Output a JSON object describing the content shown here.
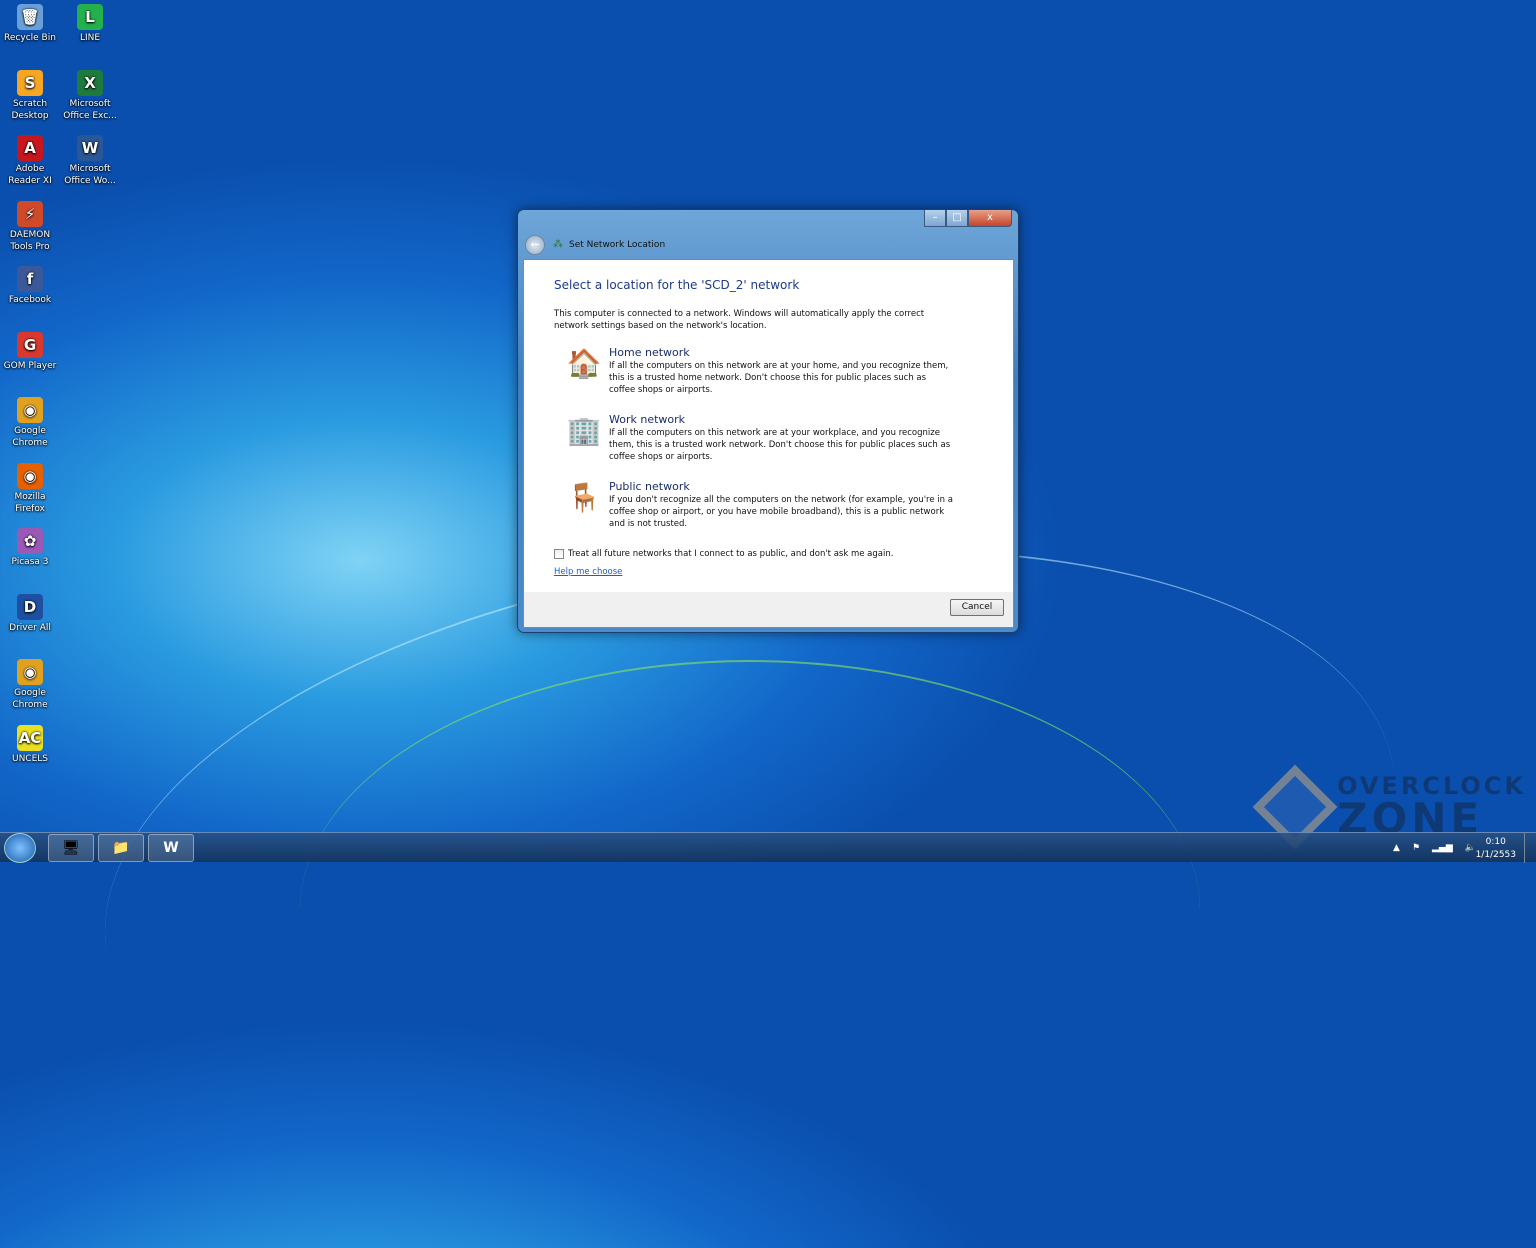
{
  "desktop": {
    "icons": [
      {
        "label": "Recycle Bin",
        "icon": "recycle-bin-icon",
        "glyph": "🗑",
        "color": "#6aa0d8"
      },
      {
        "label": "LINE",
        "icon": "line-icon",
        "glyph": "L",
        "color": "#22b14c"
      },
      {
        "label": "Scratch Desktop",
        "icon": "scratch-icon",
        "glyph": "S",
        "color": "#f6a623"
      },
      {
        "label": "Microsoft Office Exc...",
        "icon": "excel-icon",
        "glyph": "X",
        "color": "#1f7a3e"
      },
      {
        "label": "Adobe Reader XI",
        "icon": "adobe-reader-icon",
        "glyph": "A",
        "color": "#c8161d"
      },
      {
        "label": "Microsoft Office Wo...",
        "icon": "word-icon",
        "glyph": "W",
        "color": "#2b5797"
      },
      {
        "label": "DAEMON Tools Pro",
        "icon": "daemon-tools-icon",
        "glyph": "⚡",
        "color": "#d04a2a"
      },
      {
        "label": "Facebook",
        "icon": "facebook-icon",
        "glyph": "f",
        "color": "#3b5998"
      },
      {
        "label": "GOM Player",
        "icon": "gom-player-icon",
        "glyph": "G",
        "color": "#d8382e"
      },
      {
        "label": "Google Chrome",
        "icon": "chrome-icon",
        "glyph": "◉",
        "color": "#e0a020"
      },
      {
        "label": "Mozilla Firefox",
        "icon": "firefox-icon",
        "glyph": "◉",
        "color": "#e66000"
      },
      {
        "label": "Picasa 3",
        "icon": "picasa-icon",
        "glyph": "✿",
        "color": "#9b59b6"
      },
      {
        "label": "Driver All",
        "icon": "driver-all-icon",
        "glyph": "D",
        "color": "#1e4fa0"
      },
      {
        "label": "Google Chrome",
        "icon": "chrome-icon",
        "glyph": "◉",
        "color": "#e0a020"
      },
      {
        "label": "UNCELS",
        "icon": "uncels-icon",
        "glyph": "AC",
        "color": "#e8e020"
      }
    ]
  },
  "dialog": {
    "title": "Set Network Location",
    "heading": "Select a location for the 'SCD_2' network",
    "intro": "This computer is connected to a network. Windows will automatically apply the correct network settings based on the network's location.",
    "options": [
      {
        "title": "Home network",
        "desc": "If all the computers on this network are at your home, and you recognize them, this is a trusted home network. Don't choose this for public places such as coffee shops or airports.",
        "glyph": "🏠"
      },
      {
        "title": "Work network",
        "desc": "If all the computers on this network are at your workplace, and you recognize them, this is a trusted work network. Don't choose this for public places such as coffee shops or airports.",
        "glyph": "🏢"
      },
      {
        "title": "Public network",
        "desc": "If you don't recognize all the computers on the network (for example, you're in a coffee shop or airport, or you have mobile broadband), this is a public network and is not trusted.",
        "glyph": "🪑"
      }
    ],
    "checkbox_label": "Treat all future networks that I connect to as public, and don't ask me again.",
    "checkbox_checked": false,
    "help_link": "Help me choose",
    "cancel": "Cancel",
    "close_glyph": "x"
  },
  "taskbar": {
    "time": "0:10",
    "date": "1/1/2553"
  },
  "watermark": {
    "line1": "OVERCLOCK",
    "line2": "ZONE"
  }
}
